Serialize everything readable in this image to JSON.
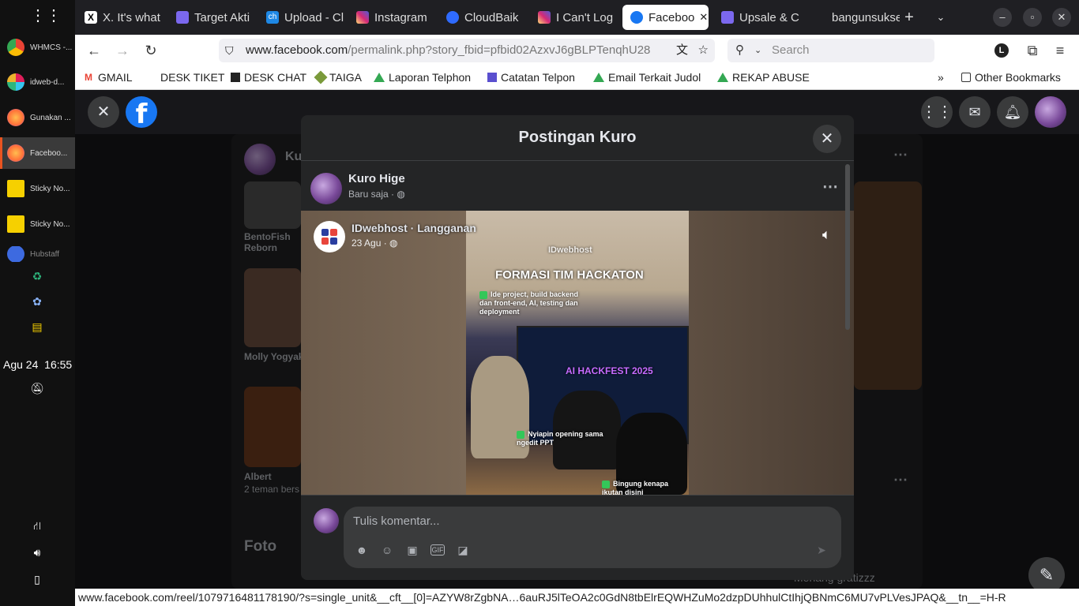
{
  "os": {
    "apps": [
      {
        "label": "WHMCS -...",
        "color": "#e8453c"
      },
      {
        "label": "idweb-d...",
        "color": "#e01e5a"
      },
      {
        "label": "Gunakan ...",
        "color": "#ff7139"
      },
      {
        "label": "Faceboo...",
        "color": "#ff7139"
      },
      {
        "label": "Sticky No...",
        "color": "#f6d000"
      },
      {
        "label": "Sticky No...",
        "color": "#f6d000"
      },
      {
        "label": "Hubstaff",
        "color": "#3d6ae0"
      }
    ],
    "date": "Agu 24",
    "time": "16:55"
  },
  "tabs": [
    {
      "label": "X. It's what",
      "icon": "x-logo-icon",
      "color": "#000000"
    },
    {
      "label": "Target Akti",
      "icon": "clickup-icon",
      "color": "#7b68ee"
    },
    {
      "label": "Upload - Cl",
      "icon": "ch-icon",
      "color": "#1e88e5"
    },
    {
      "label": "Instagram",
      "icon": "instagram-icon",
      "color": "#e1306c"
    },
    {
      "label": "CloudBaik",
      "icon": "cloud-icon",
      "color": "#2f6bff"
    },
    {
      "label": "I Can't Log",
      "icon": "instagram-icon",
      "color": "#e1306c"
    },
    {
      "label": "Faceboo",
      "icon": "facebook-icon",
      "color": "#1877f2"
    },
    {
      "label": "Upsale & C",
      "icon": "clickup-icon",
      "color": "#7b68ee"
    },
    {
      "label": "bangunsukses",
      "icon": "",
      "color": ""
    }
  ],
  "nav": {
    "url_host": "www.facebook.com",
    "url_path": "/permalink.php?story_fbid=pfbid02AzxvJ6gBLPTenqhU28",
    "search_placeholder": "Search",
    "profile_letter": "L"
  },
  "bookmarks": [
    {
      "label": "GMAIL",
      "color": "#ea4335"
    },
    {
      "label": "DESK TIKET",
      "color": ""
    },
    {
      "label": "DESK CHAT",
      "color": "#222222"
    },
    {
      "label": "TAIGA",
      "color": "#7a9a3a"
    },
    {
      "label": "Laporan Telphon",
      "color": "#34a853"
    },
    {
      "label": "Catatan Telpon",
      "color": "#5a4fcf"
    },
    {
      "label": "Email Terkait Judol",
      "color": "#34a853"
    },
    {
      "label": "REKAP ABUSE",
      "color": "#34a853"
    }
  ],
  "other_bookmarks": "Other Bookmarks",
  "background": {
    "profile_name": "Ku",
    "cards": [
      "BentoFish Reborn",
      "Molly Yogyak",
      "Albert"
    ],
    "albert_sub": "2 teman bers",
    "foto": "Foto",
    "comment_text": "Menang gratizzz"
  },
  "modal": {
    "title": "Postingan Kuro",
    "author": "Kuro Hige",
    "time": "Baru saja",
    "shared": {
      "page": "IDwebhost · Langganan",
      "date": "23 Agu",
      "brand": "IDwebhost",
      "headline": "FORMASI TIM HACKATON",
      "caption1": "Ide project, build backend dan front-end, AI, testing dan deployment",
      "caption2": "Nyiapin opening sama ngedit PPT",
      "caption3": "Bingung kenapa ikutan disini",
      "screen_title": "AI HACKFEST 2025"
    },
    "comment_placeholder": "Tulis komentar..."
  },
  "status_url": "www.facebook.com/reel/1079716481178190/?s=single_unit&__cft__[0]=AZYW8rZgbNA…6auRJ5lTeOA2c0GdN8tbElrEQWHZuMo2dzpDUhhulCtIhjQBNmC6MU7vPLVesJPAQ&__tn__=H-R"
}
